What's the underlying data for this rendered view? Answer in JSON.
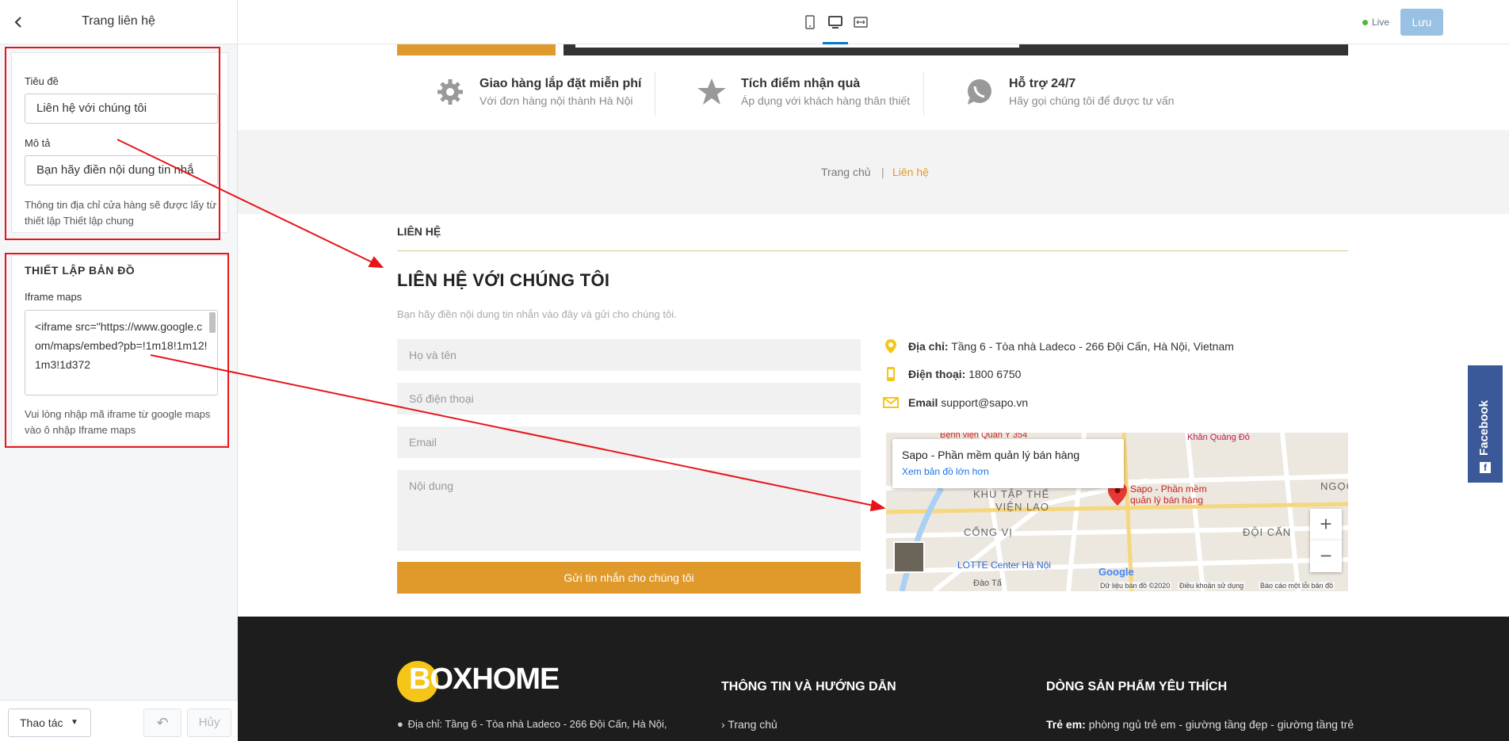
{
  "panel": {
    "title": "Trang liên hệ",
    "section_one": {
      "title_label": "Tiêu đề",
      "title_value": "Liên hệ với chúng tôi",
      "desc_label": "Mô tả",
      "desc_value": "Bạn hãy điền nội dung tin nhắ",
      "help_text": "Thông tin địa chỉ cửa hàng sẽ được lấy từ thiết lập Thiết lập chung"
    },
    "section_map": {
      "heading": "THIẾT LẬP BẢN ĐỒ",
      "iframe_label": "Iframe maps",
      "iframe_value": "<iframe src=\"https://www.google.com/maps/embed?pb=!1m18!1m12!1m3!1d372",
      "help_text": "Vui lòng nhập mã iframe từ google maps vào ô nhập Iframe maps"
    },
    "footer": {
      "actions_label": "Thao tác",
      "cancel_label": "Hủy"
    }
  },
  "toolbar": {
    "live_label": "Live",
    "save_label": "Lưu"
  },
  "site": {
    "features": [
      {
        "title": "Giao hàng lắp đặt miễn phí",
        "desc": "Với đơn hàng nội thành Hà Nội",
        "icon": "gear-icon"
      },
      {
        "title": "Tích điểm nhận quà",
        "desc": "Áp dụng với khách hàng thân thiết",
        "icon": "star-icon"
      },
      {
        "title": "Hỗ trợ 24/7",
        "desc": "Hãy gọi chúng tôi để được tư vấn",
        "icon": "whatsapp-icon"
      }
    ],
    "breadcrumb": {
      "home": "Trang chủ",
      "separator": "|",
      "current": "Liên hệ"
    },
    "page_label": "LIÊN HỆ",
    "contact": {
      "title": "LIÊN HỆ VỚI CHÚNG TÔI",
      "desc": "Bạn hãy điền nội dung tin nhắn vào đây và gửi cho chúng tôi.",
      "form": {
        "name_placeholder": "Họ và tên",
        "phone_placeholder": "Số điện thoại",
        "email_placeholder": "Email",
        "content_placeholder": "Nội dung",
        "submit_label": "Gửi tin nhắn cho chúng tôi"
      },
      "info": {
        "address_label": "Địa chỉ:",
        "address_value": "Tầng 6 - Tòa nhà Ladeco - 266 Đội Cấn, Hà Nội, Vietnam",
        "phone_label": "Điện thoại:",
        "phone_value": "1800 6750",
        "email_label": "Email",
        "email_value": "support@sapo.vn"
      },
      "map": {
        "card_title": "Sapo - Phần mềm quản lý bán hàng",
        "card_link": "Xem bản đồ lớn hơn",
        "marker_label_1": "Sapo - Phần mềm",
        "marker_label_2": "quản lý bán hàng",
        "area_1": "KHU TẬP THỂ",
        "area_2": "VIỆN LAO",
        "area_3": "CỐNG VỊ",
        "area_4": "ĐỘI CẤN",
        "area_5": "NGỌC",
        "poi_1": "Bệnh viện Quân Y 354",
        "poi_2": "Khăn Quàng Đỏ",
        "poi_3": "LOTTE Center Hà Nội",
        "poi_4": "Đào Tấ",
        "logo": "Google",
        "footer_1": "Dữ liệu bản đồ ©2020",
        "footer_2": "Điều khoản sử dụng",
        "footer_3": "Báo cáo một lỗi bản đồ"
      }
    },
    "facebook_label": "Facebook",
    "footer": {
      "logo_text": "BOXHOME",
      "address": "Địa chỉ: Tầng 6 - Tòa nhà Ladeco - 266 Đội Cấn, Hà Nội,",
      "col2_heading": "THÔNG TIN VÀ HƯỚNG DẪN",
      "col2_item": "Trang chủ",
      "col3_heading": "DÒNG SẢN PHẨM YÊU THÍCH",
      "col3_label": "Trẻ em:",
      "col3_text": "phòng ngủ trẻ em - giường tầng đẹp - giường tầng trẻ"
    }
  },
  "colors": {
    "accent": "#e09a2b",
    "annotation": "#e8141a",
    "facebook": "#3b5998",
    "primary": "#007ace"
  }
}
